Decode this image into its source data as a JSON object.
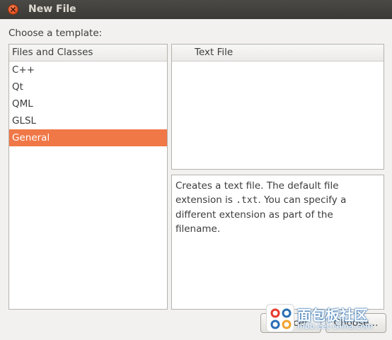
{
  "window": {
    "title": "New File"
  },
  "prompt": "Choose a template:",
  "categories": {
    "header": "Files and Classes",
    "items": [
      "C++",
      "Qt",
      "QML",
      "GLSL",
      "General"
    ],
    "selected_index": 4
  },
  "templates": {
    "items": [
      "Text File"
    ]
  },
  "description": {
    "part1": "Creates a text file. The default file extension is ",
    "code": ".txt",
    "part2": ". You can specify a different extension as part of the filename."
  },
  "buttons": {
    "cancel": "Cancel",
    "choose": "Choose..."
  },
  "colors": {
    "selection": "#f07746",
    "titlebar": "#3c3b37"
  },
  "watermark": {
    "text": "面包板社区",
    "url": "mbb.eet-china.com"
  }
}
